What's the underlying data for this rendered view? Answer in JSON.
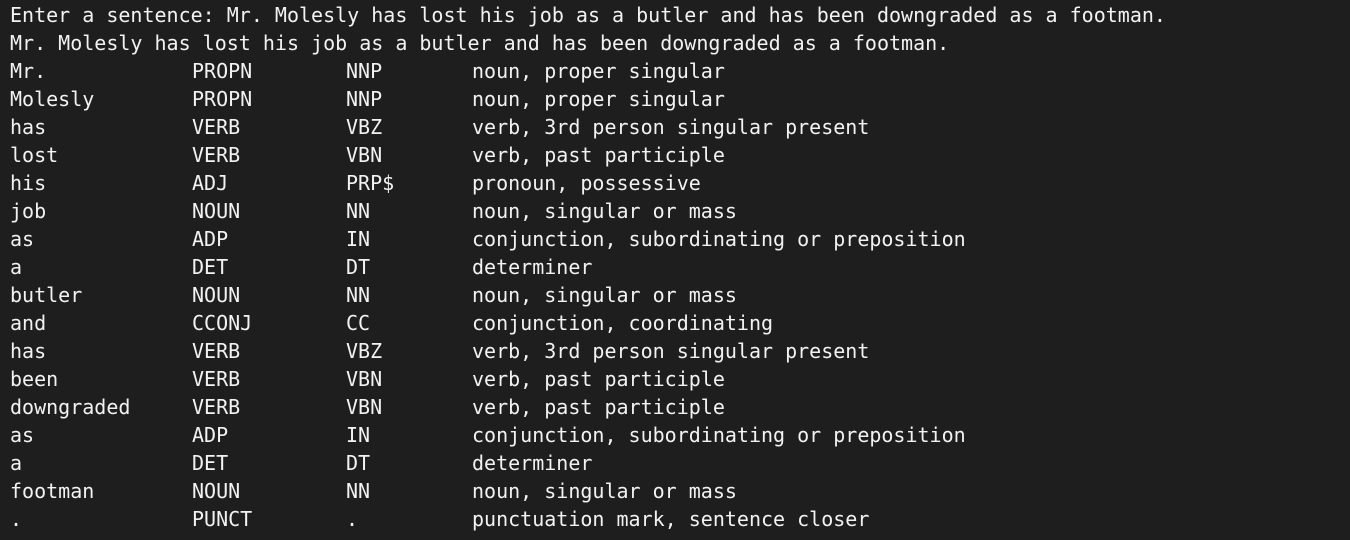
{
  "terminal": {
    "prompt_line": "Enter a sentence: Mr. Molesly has lost his job as a butler and has been downgraded as a footman.",
    "echo_line": "Mr. Molesly has lost his job as a butler and has been downgraded as a footman.",
    "rows": [
      {
        "token": "Mr.",
        "pos": "PROPN",
        "tag": "NNP",
        "desc": "noun, proper singular"
      },
      {
        "token": "Molesly",
        "pos": "PROPN",
        "tag": "NNP",
        "desc": "noun, proper singular"
      },
      {
        "token": "has",
        "pos": "VERB",
        "tag": "VBZ",
        "desc": "verb, 3rd person singular present"
      },
      {
        "token": "lost",
        "pos": "VERB",
        "tag": "VBN",
        "desc": "verb, past participle"
      },
      {
        "token": "his",
        "pos": "ADJ",
        "tag": "PRP$",
        "desc": "pronoun, possessive"
      },
      {
        "token": "job",
        "pos": "NOUN",
        "tag": "NN",
        "desc": "noun, singular or mass"
      },
      {
        "token": "as",
        "pos": "ADP",
        "tag": "IN",
        "desc": "conjunction, subordinating or preposition"
      },
      {
        "token": "a",
        "pos": "DET",
        "tag": "DT",
        "desc": "determiner"
      },
      {
        "token": "butler",
        "pos": "NOUN",
        "tag": "NN",
        "desc": "noun, singular or mass"
      },
      {
        "token": "and",
        "pos": "CCONJ",
        "tag": "CC",
        "desc": "conjunction, coordinating"
      },
      {
        "token": "has",
        "pos": "VERB",
        "tag": "VBZ",
        "desc": "verb, 3rd person singular present"
      },
      {
        "token": "been",
        "pos": "VERB",
        "tag": "VBN",
        "desc": "verb, past participle"
      },
      {
        "token": "downgraded",
        "pos": "VERB",
        "tag": "VBN",
        "desc": "verb, past participle"
      },
      {
        "token": "as",
        "pos": "ADP",
        "tag": "IN",
        "desc": "conjunction, subordinating or preposition"
      },
      {
        "token": "a",
        "pos": "DET",
        "tag": "DT",
        "desc": "determiner"
      },
      {
        "token": "footman",
        "pos": "NOUN",
        "tag": "NN",
        "desc": "noun, singular or mass"
      },
      {
        "token": ".",
        "pos": "PUNCT",
        "tag": ".",
        "desc": "punctuation mark, sentence closer"
      }
    ]
  },
  "colors": {
    "background": "#1e1e1e",
    "text": "#f2f2f2"
  }
}
